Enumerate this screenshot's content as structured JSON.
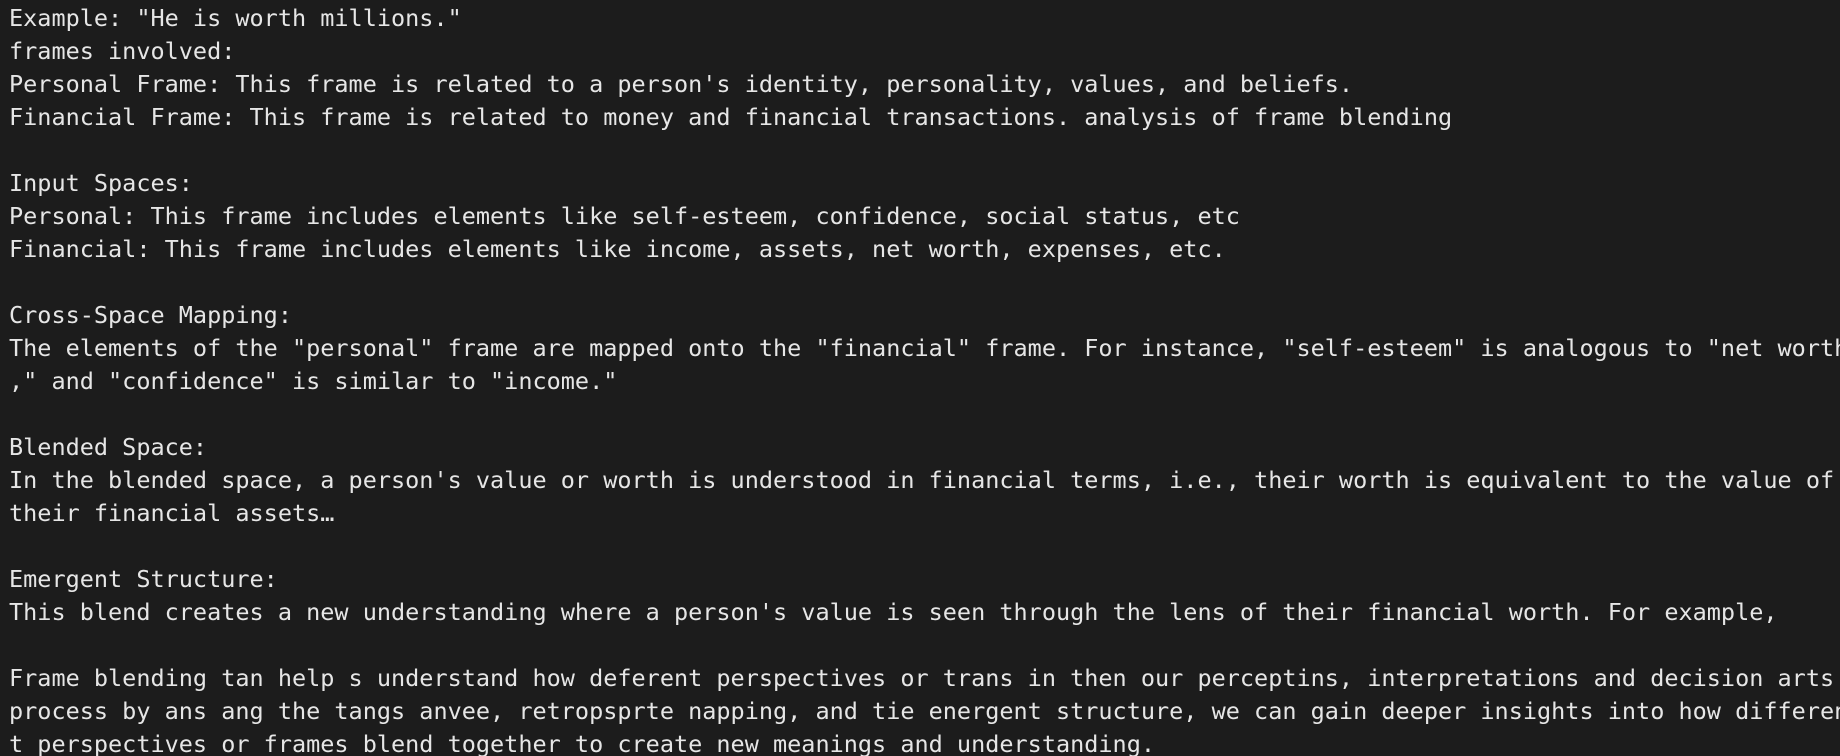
{
  "terminal": {
    "lines": [
      "Example: \"He is worth millions.\"",
      "frames involved:",
      "Personal Frame: This frame is related to a person's identity, personality, values, and beliefs.",
      "Financial Frame: This frame is related to money and financial transactions. analysis of frame blending",
      "",
      "Input Spaces:",
      "Personal: This frame includes elements like self-esteem, confidence, social status, etc",
      "Financial: This frame includes elements like income, assets, net worth, expenses, etc.",
      "",
      "Cross-Space Mapping:",
      "The elements of the \"personal\" frame are mapped onto the \"financial\" frame. For instance, \"self-esteem\" is analogous to \"net worth",
      ",\" and \"confidence\" is similar to \"income.\"",
      "",
      "Blended Space:",
      "In the blended space, a person's value or worth is understood in financial terms, i.e., their worth is equivalent to the value of",
      "their financial assets…",
      "",
      "Emergent Structure:",
      "This blend creates a new understanding where a person's value is seen through the lens of their financial worth. For example,",
      "",
      "Frame blending tan help s understand how deferent perspectives or trans in then our perceptins, interpretations and decision arts",
      "process by ans ang the tangs anvee, retropsprte napping, and tie energent structure, we can gain deeper insights into how differen",
      "t perspectives or frames blend together to create new meanings and understanding."
    ]
  }
}
